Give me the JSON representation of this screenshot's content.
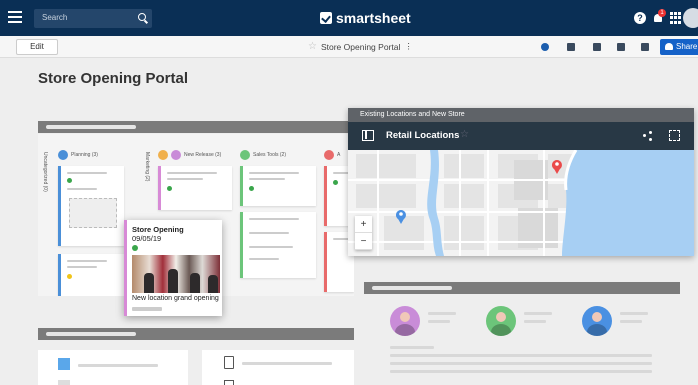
{
  "navbar": {
    "search_placeholder": "Search",
    "brand": "smartsheet",
    "help_label": "?",
    "notification_count": "1"
  },
  "toolbar": {
    "edit_label": "Edit",
    "doc_title": "Store Opening Portal",
    "more_glyph": "⋮",
    "share_label": "Share"
  },
  "page": {
    "title": "Store Opening Portal"
  },
  "board": {
    "columns": [
      {
        "label": "Planning (3)"
      },
      {
        "label": "New Release (3)"
      },
      {
        "label": "Sales Tools (2)"
      },
      {
        "label": "A"
      }
    ],
    "side_labels": [
      "Uncategorized (0)",
      "Marketing (2)"
    ]
  },
  "popup_card": {
    "title": "Store Opening",
    "date": "09/05/19",
    "text": "New location grand opening"
  },
  "map": {
    "caption": "Existing Locations and New Store",
    "title": "Retail Locations",
    "zoom_in": "+",
    "zoom_out": "−",
    "colors": {
      "water": "#a7cff3",
      "land": "#f3f3f3",
      "road": "#ffffff",
      "pin_red": "#ea4a4a",
      "pin_blue": "#4a90e2"
    }
  },
  "colors": {
    "navbar": "#0a2f55",
    "share": "#1562c8",
    "panel_header": "#283845"
  }
}
